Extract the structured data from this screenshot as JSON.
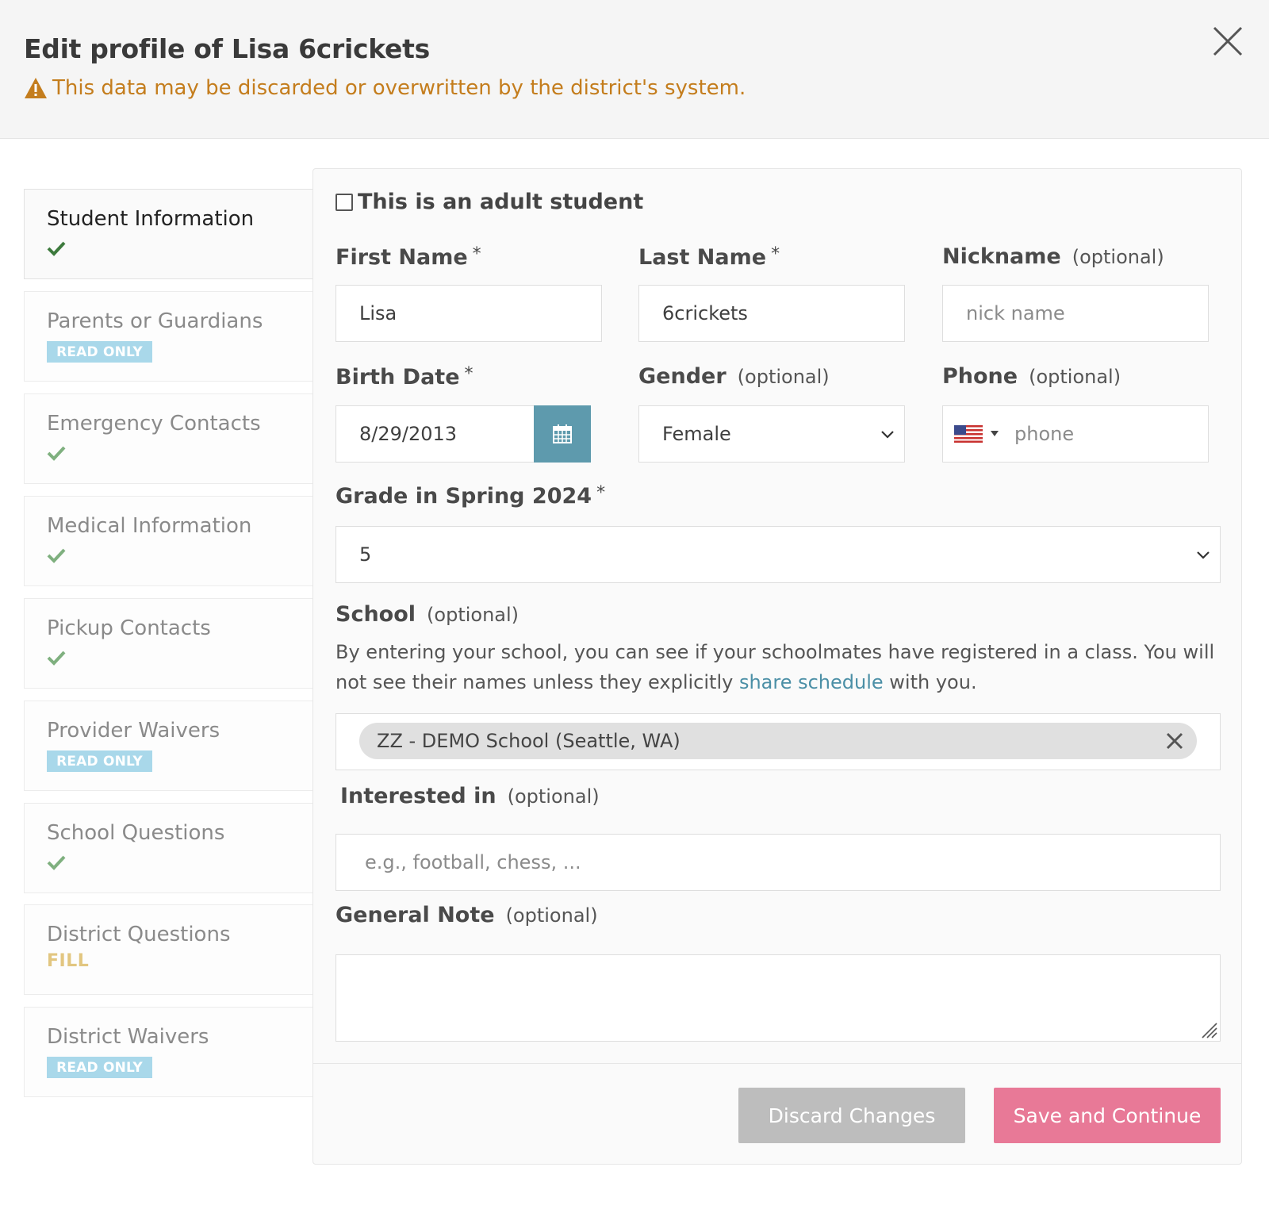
{
  "header": {
    "title": "Edit profile of Lisa 6crickets",
    "warning": "This data may be discarded or overwritten by the district's system.",
    "warning_icon": "warning-triangle-icon",
    "close_icon": "close-icon"
  },
  "colors": {
    "warning": "#c47d1d",
    "accent_calendar": "#5e9aad",
    "save_button": "#e87997",
    "discard_button": "#bdbdbd",
    "read_only_badge": "#a9d8ea",
    "fill_badge": "#e2c680",
    "check_active": "#3d7a3d",
    "check_inactive": "#7fb07f",
    "link": "#4b8fa6"
  },
  "sidebar": {
    "items": [
      {
        "label": "Student Information",
        "status": "check",
        "active": true
      },
      {
        "label": "Parents or Guardians",
        "status": "READ ONLY"
      },
      {
        "label": "Emergency Contacts",
        "status": "check"
      },
      {
        "label": "Medical Information",
        "status": "check"
      },
      {
        "label": "Pickup Contacts",
        "status": "check"
      },
      {
        "label": "Provider Waivers",
        "status": "READ ONLY"
      },
      {
        "label": "School Questions",
        "status": "check"
      },
      {
        "label": "District Questions",
        "status": "FILL"
      },
      {
        "label": "District Waivers",
        "status": "READ ONLY"
      }
    ]
  },
  "form": {
    "adult_checkbox": {
      "label": "This is an adult student",
      "checked": false
    },
    "first_name": {
      "label": "First Name",
      "required": "*",
      "value": "Lisa"
    },
    "last_name": {
      "label": "Last Name",
      "required": "*",
      "value": "6crickets"
    },
    "nickname": {
      "label": "Nickname",
      "optional": "(optional)",
      "placeholder": "nick name"
    },
    "birth_date": {
      "label": "Birth Date",
      "required": "*",
      "value": "8/29/2013",
      "icon": "calendar-icon"
    },
    "gender": {
      "label": "Gender",
      "optional": "(optional)",
      "value": "Female"
    },
    "phone": {
      "label": "Phone",
      "optional": "(optional)",
      "placeholder": "phone",
      "flag_icon": "us-flag-icon"
    },
    "grade": {
      "label": "Grade in Spring 2024",
      "required": "*",
      "value": "5"
    },
    "school": {
      "label": "School",
      "optional": "(optional)",
      "help_before": "By entering your school, you can see if your schoolmates have registered in a class. You will not see their names unless they explicitly ",
      "help_link": "share schedule",
      "help_after": " with you.",
      "selected": "ZZ - DEMO School (Seattle, WA)"
    },
    "interested": {
      "label": "Interested in",
      "optional": "(optional)",
      "placeholder": "e.g., football, chess, ..."
    },
    "note": {
      "label": "General Note",
      "optional": "(optional)",
      "value": ""
    }
  },
  "actions": {
    "discard": "Discard Changes",
    "save": "Save and Continue"
  }
}
